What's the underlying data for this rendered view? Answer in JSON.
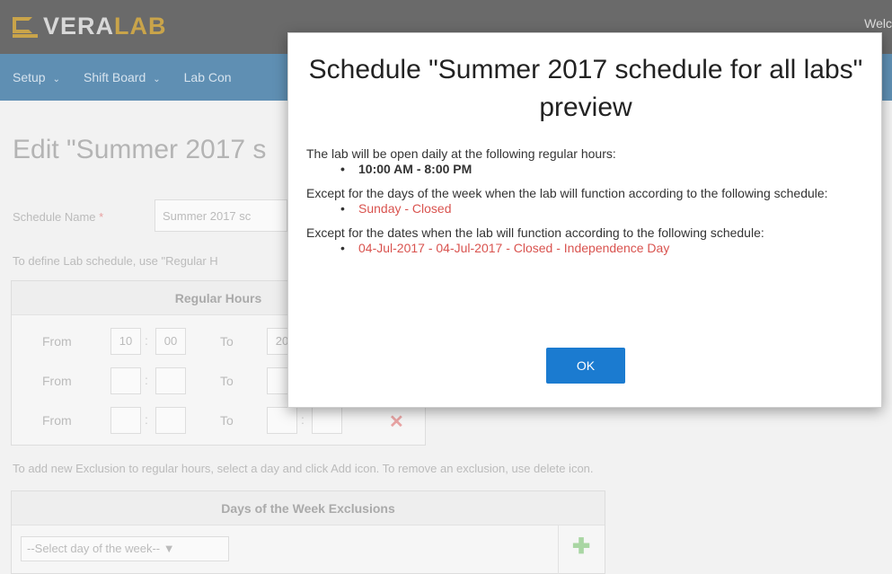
{
  "header": {
    "logo_part1": "VERA",
    "logo_part2": "LAB",
    "welcome": "Welc"
  },
  "nav": {
    "items": [
      {
        "label": "Setup"
      },
      {
        "label": "Shift Board"
      },
      {
        "label": "Lab Con"
      }
    ],
    "chevron": "⌄"
  },
  "page": {
    "title": "Edit \"Summer 2017 s",
    "schedule_name_label": "Schedule Name",
    "required_mark": "*",
    "schedule_name_value": "Summer 2017 sc",
    "hint_regular": "To define Lab schedule, use \"Regular H",
    "regular_hours": {
      "header": "Regular Hours",
      "rows": [
        {
          "from_label": "From",
          "from_h": "10",
          "from_m": "00",
          "to_label": "To",
          "to_h": "20",
          "to_m": ""
        },
        {
          "from_label": "From",
          "from_h": "",
          "from_m": "",
          "to_label": "To",
          "to_h": "",
          "to_m": ""
        },
        {
          "from_label": "From",
          "from_h": "",
          "from_m": "",
          "to_label": "To",
          "to_h": "",
          "to_m": ""
        }
      ],
      "colon": ":"
    },
    "hint_exclusion": "To add new Exclusion to regular hours, select a day and click Add icon. To remove an exclusion, use delete icon.",
    "exclusions": {
      "header": "Days of the Week Exclusions",
      "select_value": "--Select day of the week--",
      "select_arrow": "▼"
    }
  },
  "modal": {
    "title": "Schedule \"Summer 2017 schedule for all labs\" preview",
    "regular_intro": "The lab will be open daily at the following regular hours:",
    "regular_items": [
      "10:00 AM - 8:00 PM"
    ],
    "weekday_intro": "Except for the days of the week when the lab will function according to the following schedule:",
    "weekday_items": [
      "Sunday - Closed"
    ],
    "dates_intro": "Except for the dates when the lab will function according to the following schedule:",
    "date_items": [
      "04-Jul-2017 - 04-Jul-2017 - Closed - Independence Day"
    ],
    "ok_label": "OK"
  },
  "colors": {
    "header_bg": "#6a6a6a",
    "nav_bg": "#5f8fb3",
    "logo_accent": "#c9a44a",
    "ok_button": "#1b7bd0",
    "exception_text": "#d9534f"
  }
}
